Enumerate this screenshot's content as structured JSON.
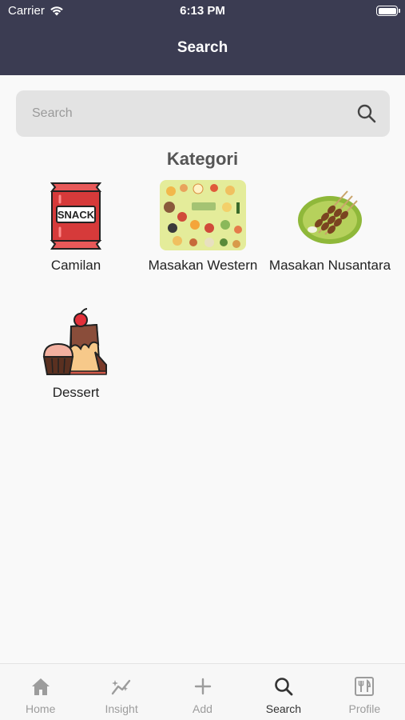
{
  "status_bar": {
    "carrier": "Carrier",
    "time": "6:13 PM"
  },
  "header": {
    "title": "Search"
  },
  "search": {
    "placeholder": "Search",
    "value": ""
  },
  "section": {
    "title": "Kategori"
  },
  "categories": [
    {
      "label": "Camilan",
      "image_icon": "snack-bag-icon"
    },
    {
      "label": "Masakan Western",
      "image_icon": "western-food-collage-image"
    },
    {
      "label": "Masakan Nusantara",
      "image_icon": "satay-plate-image"
    },
    {
      "label": "Dessert",
      "image_icon": "cake-cupcake-icon"
    }
  ],
  "snack_text": "SNACK",
  "tabs": [
    {
      "label": "Home",
      "icon": "home-icon",
      "active": false
    },
    {
      "label": "Insight",
      "icon": "insight-icon",
      "active": false
    },
    {
      "label": "Add",
      "icon": "plus-icon",
      "active": false
    },
    {
      "label": "Search",
      "icon": "search-icon",
      "active": true
    },
    {
      "label": "Profile",
      "icon": "restaurant-icon",
      "active": false
    }
  ],
  "colors": {
    "header_bg": "#3b3c52",
    "active_tab": "#333333",
    "inactive_tab": "#9c9c9c"
  }
}
